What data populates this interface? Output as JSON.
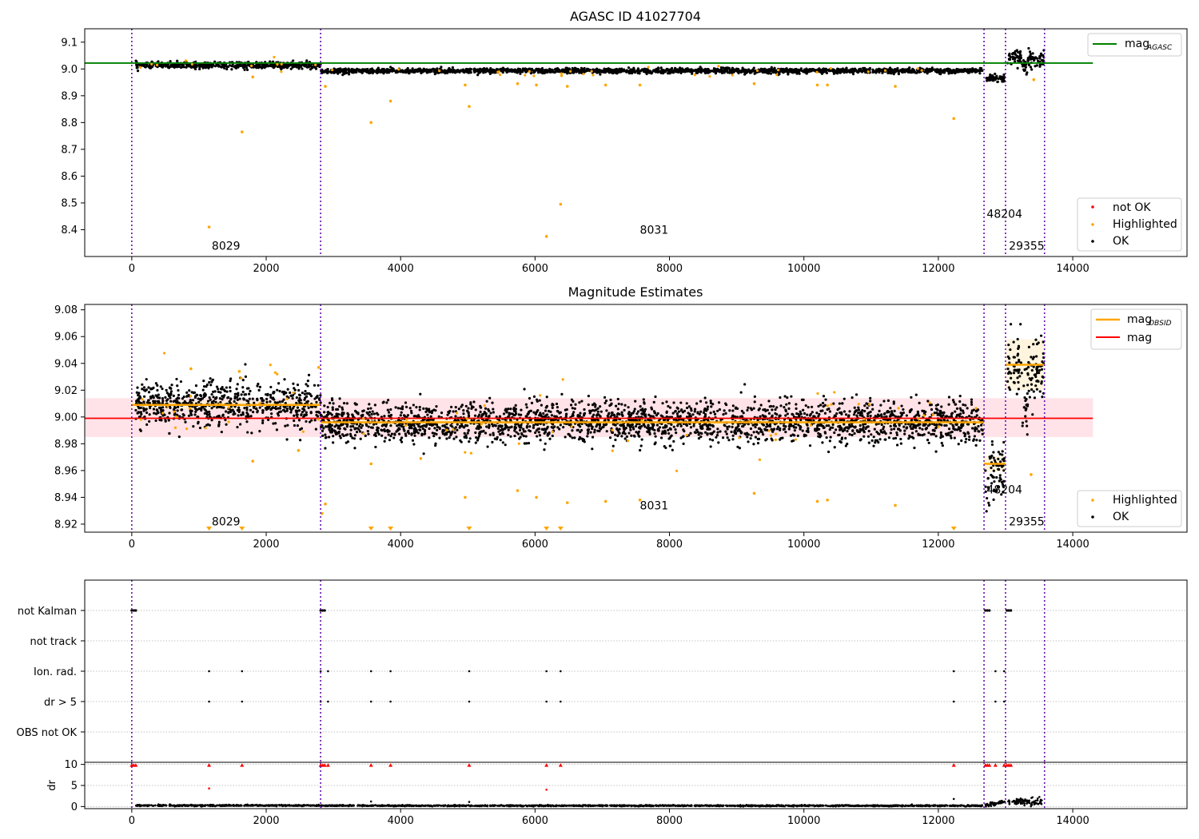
{
  "colors": {
    "ok": "#000000",
    "highlighted": "#ffa500",
    "not_ok": "#ff0000",
    "agasc_line": "#008000",
    "mag_line": "#ff0000",
    "mag_band": "#ffc0cb",
    "obsid_line": "#ffa500",
    "obsid_band": "#fff2d6",
    "obs_boundary": "#6a0dad"
  },
  "chart_data": [
    {
      "type": "scatter",
      "title": "AGASC ID 41027704",
      "xlabel": "",
      "ylabel": "",
      "xlim": [
        -700,
        15700
      ],
      "ylim": [
        8.3,
        9.15
      ],
      "x_ticks": [
        0,
        2000,
        4000,
        6000,
        8000,
        10000,
        12000,
        14000
      ],
      "x_tick_labels": [
        "0",
        "2000",
        "4000",
        "6000",
        "8000",
        "10000",
        "12000",
        "14000"
      ],
      "y_ticks": [
        8.4,
        8.5,
        8.6,
        8.7,
        8.8,
        8.9,
        9.0,
        9.1
      ],
      "y_tick_labels": [
        "8.4",
        "8.5",
        "8.6",
        "8.7",
        "8.8",
        "8.9",
        "9.0",
        "9.1"
      ],
      "obs_boundaries": [
        0,
        2810,
        12680,
        13000,
        13580
      ],
      "mag_agasc": {
        "value": 9.022,
        "x_range": [
          -700,
          14300
        ]
      },
      "legend_top": {
        "label": "mag",
        "sub": "AGASC",
        "placement": "top-right"
      },
      "legend_bottom": {
        "entries": [
          "not OK",
          "Highlighted",
          "OK"
        ],
        "placement": "bottom-right"
      },
      "annotations": [
        {
          "text": "8029",
          "x": 1190,
          "y": 8.325
        },
        {
          "text": "8031",
          "x": 7560,
          "y": 8.385
        },
        {
          "text": "48204",
          "x": 12720,
          "y": 8.445
        },
        {
          "text": "29355",
          "x": 13050,
          "y": 8.325
        }
      ],
      "highlighted_points": [
        {
          "x": 1150,
          "y": 8.41
        },
        {
          "x": 1640,
          "y": 8.765
        },
        {
          "x": 1800,
          "y": 8.97
        },
        {
          "x": 2880,
          "y": 8.935
        },
        {
          "x": 3560,
          "y": 8.8
        },
        {
          "x": 3850,
          "y": 8.88
        },
        {
          "x": 4960,
          "y": 8.94
        },
        {
          "x": 5020,
          "y": 8.86
        },
        {
          "x": 5740,
          "y": 8.945
        },
        {
          "x": 6020,
          "y": 8.94
        },
        {
          "x": 6170,
          "y": 8.375
        },
        {
          "x": 6380,
          "y": 8.495
        },
        {
          "x": 6480,
          "y": 8.935
        },
        {
          "x": 7050,
          "y": 8.94
        },
        {
          "x": 7560,
          "y": 8.94
        },
        {
          "x": 9260,
          "y": 8.945
        },
        {
          "x": 10200,
          "y": 8.94
        },
        {
          "x": 10350,
          "y": 8.94
        },
        {
          "x": 11360,
          "y": 8.935
        },
        {
          "x": 12230,
          "y": 8.815
        },
        {
          "x": 13420,
          "y": 8.96
        }
      ]
    },
    {
      "type": "scatter",
      "title": "Magnitude Estimates",
      "xlabel": "",
      "ylabel": "",
      "xlim": [
        -700,
        15700
      ],
      "ylim": [
        8.914,
        9.084
      ],
      "x_ticks": [
        0,
        2000,
        4000,
        6000,
        8000,
        10000,
        12000,
        14000
      ],
      "x_tick_labels": [
        "0",
        "2000",
        "4000",
        "6000",
        "8000",
        "10000",
        "12000",
        "14000"
      ],
      "y_ticks": [
        8.92,
        8.94,
        8.96,
        8.98,
        9.0,
        9.02,
        9.04,
        9.06,
        9.08
      ],
      "y_tick_labels": [
        "8.92",
        "8.94",
        "8.96",
        "8.98",
        "9.00",
        "9.02",
        "9.04",
        "9.06",
        "9.08"
      ],
      "obs_boundaries": [
        0,
        2810,
        12680,
        13000,
        13580
      ],
      "mag": {
        "value": 8.999,
        "band": [
          8.985,
          9.014
        ],
        "x_range": [
          -700,
          14300
        ]
      },
      "mag_obsid": [
        {
          "x0": 0,
          "x1": 2810,
          "value": 9.009,
          "band": [
            9.006,
            9.012
          ]
        },
        {
          "x0": 2810,
          "x1": 12680,
          "value": 8.996,
          "band": [
            8.993,
            8.999
          ]
        },
        {
          "x0": 12680,
          "x1": 13000,
          "value": 8.965,
          "band": [
            8.959,
            8.971
          ]
        },
        {
          "x0": 13000,
          "x1": 13580,
          "value": 9.039,
          "band": [
            9.02,
            9.058
          ]
        }
      ],
      "legend_top": {
        "entries": [
          {
            "label": "mag",
            "sub": "OBSID"
          },
          {
            "label": "mag",
            "sub": ""
          }
        ],
        "placement": "top-right"
      },
      "legend_bottom": {
        "entries": [
          "Highlighted",
          "OK"
        ],
        "placement": "bottom-right"
      },
      "annotations": [
        {
          "text": "8029",
          "x": 1190,
          "y": 8.919
        },
        {
          "text": "8031",
          "x": 7560,
          "y": 8.931
        },
        {
          "text": "48204",
          "x": 12720,
          "y": 8.943
        },
        {
          "text": "29355",
          "x": 13050,
          "y": 8.919
        }
      ],
      "highlighted_points": [
        {
          "x": 880,
          "y": 9.036
        },
        {
          "x": 1600,
          "y": 9.034
        },
        {
          "x": 1800,
          "y": 8.967
        },
        {
          "x": 2480,
          "y": 8.975
        },
        {
          "x": 2780,
          "y": 9.037
        },
        {
          "x": 2830,
          "y": 8.928
        },
        {
          "x": 2880,
          "y": 8.935
        },
        {
          "x": 3560,
          "y": 8.965
        },
        {
          "x": 4300,
          "y": 8.969
        },
        {
          "x": 4960,
          "y": 8.94
        },
        {
          "x": 5740,
          "y": 8.945
        },
        {
          "x": 6020,
          "y": 8.94
        },
        {
          "x": 6480,
          "y": 8.936
        },
        {
          "x": 7050,
          "y": 8.937
        },
        {
          "x": 7560,
          "y": 8.938
        },
        {
          "x": 9260,
          "y": 8.943
        },
        {
          "x": 10200,
          "y": 8.937
        },
        {
          "x": 10350,
          "y": 8.938
        },
        {
          "x": 11360,
          "y": 8.934
        },
        {
          "x": 13380,
          "y": 8.957
        }
      ],
      "below_range_markers": [
        1150,
        1640,
        3560,
        3850,
        5020,
        6170,
        6380,
        12230
      ]
    },
    {
      "type": "scatter",
      "title": "",
      "xlabel": "",
      "ylabel": "",
      "xlim": [
        -700,
        15700
      ],
      "flag_rows": [
        "not Kalman",
        "not track",
        "Ion. rad.",
        "dr > 5",
        "OBS not OK"
      ],
      "flag_points": {
        "not Kalman": [
          0,
          30,
          60,
          2810,
          2840,
          2870,
          12700,
          12730,
          12760,
          13020,
          13050,
          13080
        ],
        "not track": [],
        "Ion. rad.": [
          1150,
          1640,
          2810,
          2920,
          3560,
          3850,
          5020,
          6170,
          6380,
          12230,
          12850,
          12980
        ],
        "dr > 5": [
          1150,
          1640,
          2810,
          2920,
          3560,
          3850,
          5020,
          6170,
          6380,
          12230,
          12850,
          12980
        ],
        "OBS not OK": []
      },
      "obs_boundaries": [
        0,
        2810,
        12680,
        13000,
        13580
      ]
    },
    {
      "type": "scatter",
      "title": "",
      "xlabel": "",
      "ylabel": "dr",
      "xlim": [
        -700,
        15700
      ],
      "ylim": [
        -0.5,
        10.5
      ],
      "x_ticks": [
        0,
        2000,
        4000,
        6000,
        8000,
        10000,
        12000,
        14000
      ],
      "x_tick_labels": [
        "0",
        "2000",
        "4000",
        "6000",
        "8000",
        "10000",
        "12000",
        "14000"
      ],
      "y_ticks": [
        0,
        5,
        10
      ],
      "y_tick_labels": [
        "0",
        "5",
        "10"
      ],
      "obs_boundaries": [
        0,
        2810,
        12680,
        13000,
        13580
      ],
      "clipped_markers": [
        0,
        30,
        60,
        1150,
        1640,
        2810,
        2840,
        2870,
        2920,
        3560,
        3850,
        5020,
        6170,
        6380,
        12230,
        12700,
        12730,
        12760,
        12850,
        12980,
        13020,
        13050,
        13080
      ],
      "outliers": [
        {
          "x": 1150,
          "y": 4.3
        },
        {
          "x": 6170,
          "y": 4.0
        },
        {
          "x": 12230,
          "y": 1.8
        },
        {
          "x": 3560,
          "y": 1.2
        },
        {
          "x": 5020,
          "y": 1.1
        }
      ]
    }
  ]
}
